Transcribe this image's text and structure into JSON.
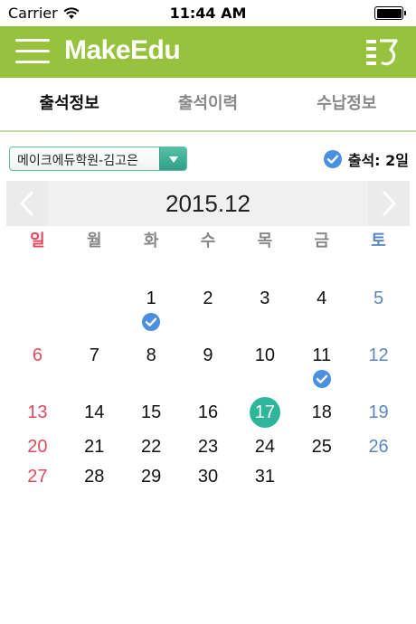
{
  "status_bar": {
    "carrier": "Carrier",
    "time": "11:44 AM"
  },
  "nav": {
    "logo": "MakeEdu",
    "left_icon": "hamburger-menu-icon",
    "right_icon": "book-list-icon"
  },
  "tabs": [
    {
      "label": "출석정보",
      "active": true
    },
    {
      "label": "출석이력",
      "active": false
    },
    {
      "label": "수납정보",
      "active": false
    }
  ],
  "selector": {
    "value": "메이크에듀학원-김고은"
  },
  "attendance": {
    "label": "출석: 2일"
  },
  "calendar": {
    "title": "2015.12",
    "weekdays": [
      "일",
      "월",
      "화",
      "수",
      "목",
      "금",
      "토"
    ],
    "days": [
      {
        "day": "1",
        "checked": true
      },
      {
        "day": "2"
      },
      {
        "day": "3"
      },
      {
        "day": "4"
      },
      {
        "day": "5"
      },
      {
        "day": "6"
      },
      {
        "day": "7"
      },
      {
        "day": "8"
      },
      {
        "day": "9"
      },
      {
        "day": "10"
      },
      {
        "day": "11",
        "checked": true
      },
      {
        "day": "12"
      },
      {
        "day": "13"
      },
      {
        "day": "14"
      },
      {
        "day": "15"
      },
      {
        "day": "16"
      },
      {
        "day": "17",
        "today": true
      },
      {
        "day": "18"
      },
      {
        "day": "19"
      },
      {
        "day": "20"
      },
      {
        "day": "21"
      },
      {
        "day": "22"
      },
      {
        "day": "23"
      },
      {
        "day": "24"
      },
      {
        "day": "25"
      },
      {
        "day": "26"
      },
      {
        "day": "27"
      },
      {
        "day": "28"
      },
      {
        "day": "29"
      },
      {
        "day": "30"
      },
      {
        "day": "31"
      }
    ]
  },
  "colors": {
    "nav_bg": "#97c23d",
    "sunday": "#e04a5e",
    "saturday": "#5b86c4",
    "today": "#2fb59a",
    "check": "#4a8fe0"
  }
}
